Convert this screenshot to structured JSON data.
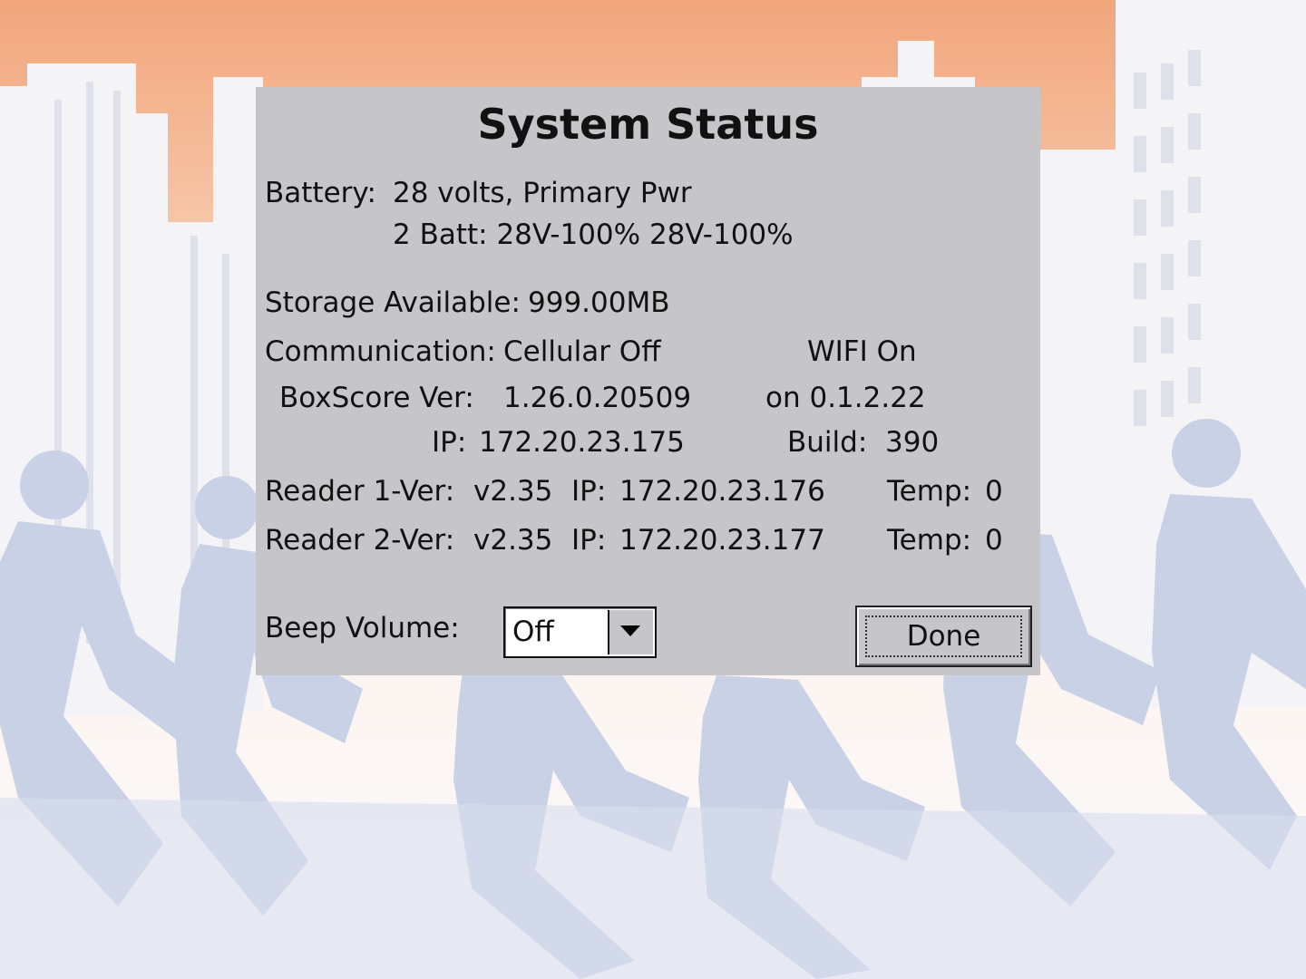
{
  "dialog": {
    "title": "System Status",
    "battery": {
      "label": "Battery:",
      "line1": "28 volts, Primary Pwr",
      "line2": "2 Batt: 28V-100% 28V-100%"
    },
    "storage": {
      "label": "Storage Available:",
      "value": "999.00MB"
    },
    "communication": {
      "label": "Communication:",
      "cellular": "Cellular Off",
      "wifi": "WIFI On"
    },
    "boxscore": {
      "label": "BoxScore Ver:",
      "version": "1.26.0.20509",
      "on_version": "on 0.1.2.22",
      "ip_label": "IP:",
      "ip": "172.20.23.175",
      "build_label": "Build:",
      "build": "390"
    },
    "readers": [
      {
        "label": "Reader 1-Ver:",
        "version": "v2.35",
        "ip_label": "IP:",
        "ip": "172.20.23.176",
        "temp_label": "Temp:",
        "temp": "0"
      },
      {
        "label": "Reader 2-Ver:",
        "version": "v2.35",
        "ip_label": "IP:",
        "ip": "172.20.23.177",
        "temp_label": "Temp:",
        "temp": "0"
      }
    ],
    "beep_volume": {
      "label": "Beep Volume:",
      "selected": "Off"
    },
    "done_label": "Done"
  },
  "colors": {
    "dialog_bg": "#c6c5ca",
    "sky_top": "#f2a67c",
    "runner_silhouette": "#c9d1e6",
    "building": "#f4f4f6"
  }
}
